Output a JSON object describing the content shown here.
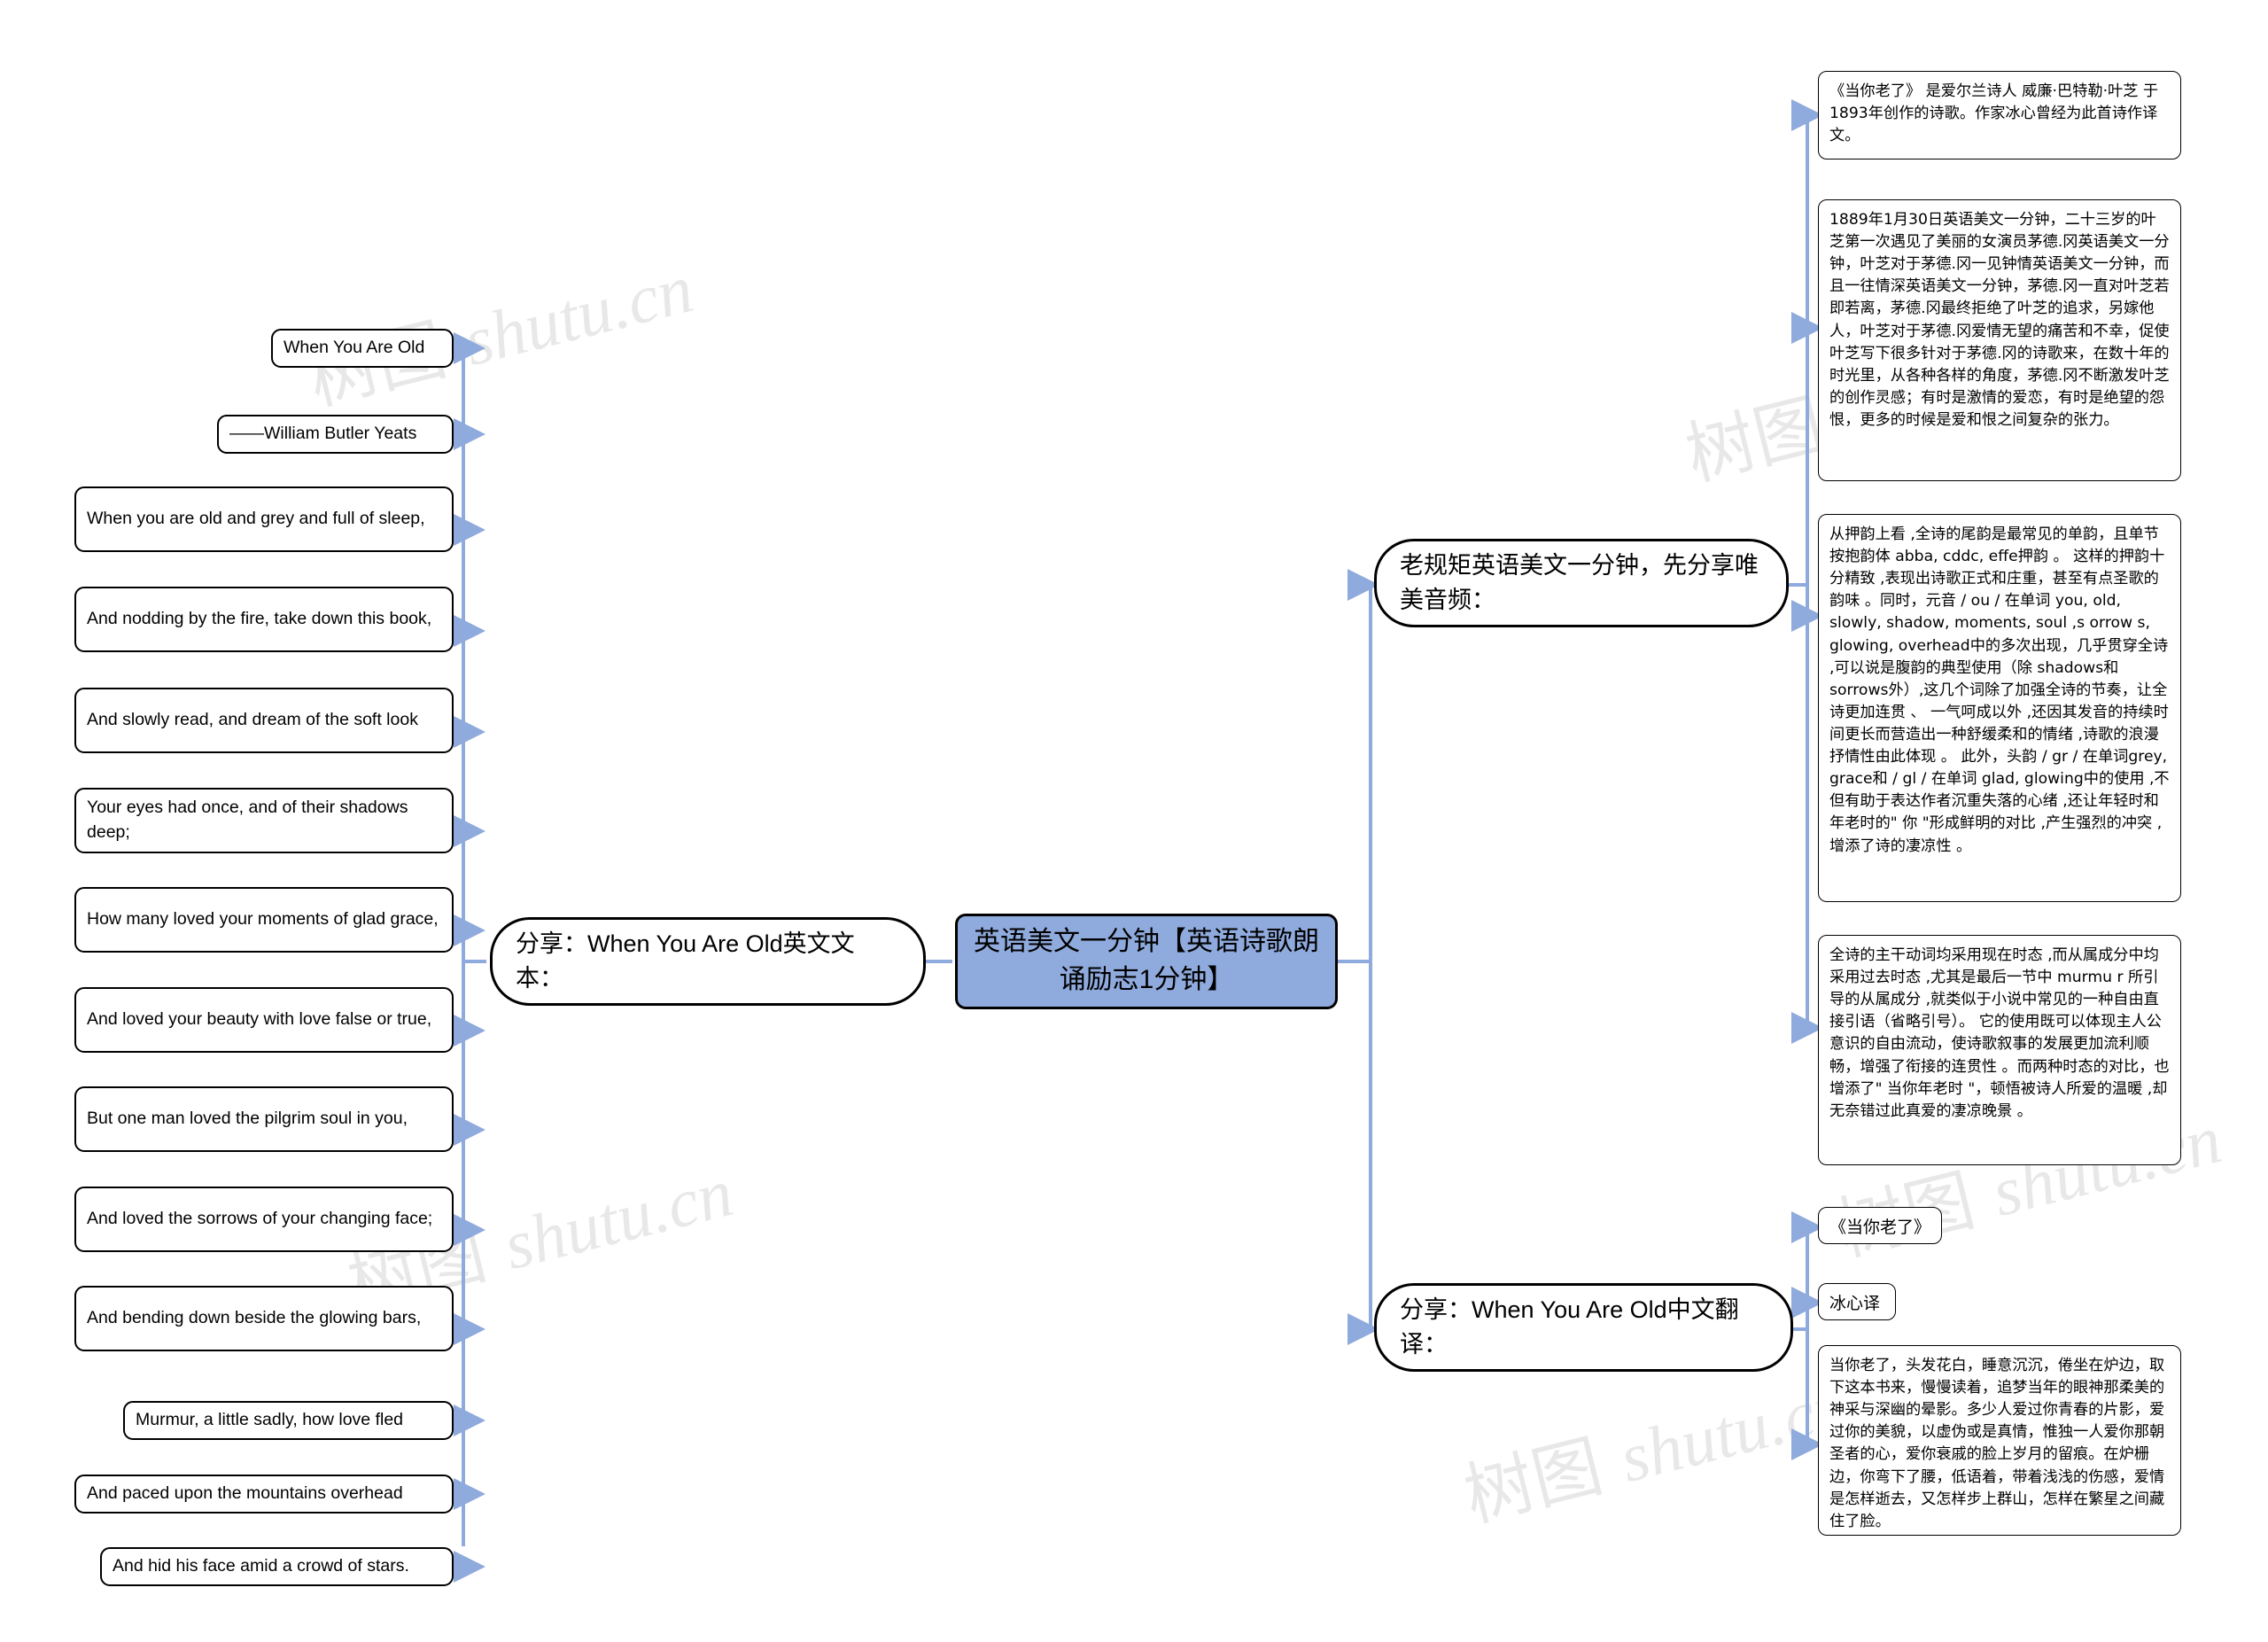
{
  "meta": {
    "watermark_text_a": "树图 ",
    "watermark_text_b": "shutu.cn",
    "accent_node_color": "#8FAADC",
    "connector_color": "#8FAADC",
    "node_border_color": "#000000",
    "canvas_background": "#FFFFFF"
  },
  "root": {
    "label": "英语美文一分钟【英语诗歌朗诵励志1分钟】"
  },
  "branches": {
    "left": {
      "label": "分享：When You Are Old英文文本：",
      "children": [
        {
          "label": "When You Are Old"
        },
        {
          "label": "——William Butler Yeats"
        },
        {
          "label": "When you are old and grey and full of sleep,"
        },
        {
          "label": "And nodding by the fire, take down this book,"
        },
        {
          "label": "And slowly read, and dream of the soft look"
        },
        {
          "label": "Your eyes had once, and of their shadows deep;"
        },
        {
          "label": "How many loved your moments of glad grace,"
        },
        {
          "label": "And loved your beauty with love false or true,"
        },
        {
          "label": "But one man loved the pilgrim soul in you,"
        },
        {
          "label": "And loved the sorrows of your changing face;"
        },
        {
          "label": "And bending down beside the glowing bars,"
        },
        {
          "label": "Murmur, a little sadly, how love fled"
        },
        {
          "label": "And paced upon the mountains overhead"
        },
        {
          "label": "And hid his face amid a crowd of stars."
        }
      ]
    },
    "right_top": {
      "label": "老规矩英语美文一分钟，先分享唯美音频：",
      "children": [
        {
          "label": "《当你老了》 是爱尔兰诗人 威廉·巴特勒·叶芝 于1893年创作的诗歌。作家冰心曾经为此首诗作译文。"
        },
        {
          "label": "1889年1月30日英语美文一分钟，二十三岁的叶芝第一次遇见了美丽的女演员茅德.冈英语美文一分钟，叶芝对于茅德.冈一见钟情英语美文一分钟，而且一往情深英语美文一分钟，茅德.冈一直对叶芝若即若离，茅德.冈最终拒绝了叶芝的追求，另嫁他人，叶芝对于茅德.冈爱情无望的痛苦和不幸，促使叶芝写下很多针对于茅德.冈的诗歌来，在数十年的时光里，从各种各样的角度，茅德.冈不断激发叶芝的创作灵感；有时是激情的爱恋，有时是绝望的怨恨，更多的时候是爱和恨之间复杂的张力。"
        },
        {
          "label": "从押韵上看 ,全诗的尾韵是最常见的单韵，且单节按抱韵体 abba, cddc, effe押韵 。 这样的押韵十分精致 ,表现出诗歌正式和庄重，甚至有点圣歌的韵味 。同时，元音 / ou / 在单词 you, old, slowly, shadow, moments, soul ,s orrow s, glowing, overhead中的多次出现，几乎贯穿全诗 ,可以说是腹韵的典型使用（除 shadows和 sorrows外）,这几个词除了加强全诗的节奏，让全诗更加连贯 、 一气呵成以外 ,还因其发音的持续时间更长而营造出一种舒缓柔和的情绪 ,诗歌的浪漫抒情性由此体现 。 此外，头韵 / gr / 在单词grey, grace和 / gl / 在单词 glad, glowing中的使用 ,不但有助于表达作者沉重失落的心绪 ,还让年轻时和年老时的\" 你 \"形成鲜明的对比 ,产生强烈的冲突 ,增添了诗的凄凉性 。"
        },
        {
          "label": "全诗的主干动词均采用现在时态 ,而从属成分中均采用过去时态 ,尤其是最后一节中 murmu r 所引导的从属成分 ,就类似于小说中常见的一种自由直接引语（省略引号）。 它的使用既可以体现主人公意识的自由流动，使诗歌叙事的发展更加流利顺畅，增强了衔接的连贯性 。而两种时态的对比，也增添了\" 当你年老时 \"，顿悟被诗人所爱的温暖 ,却无奈错过此真爱的凄凉晚景 。"
        }
      ]
    },
    "right_bottom": {
      "label": "分享：When You Are Old中文翻译：",
      "children": [
        {
          "label": "《当你老了》"
        },
        {
          "label": "冰心译"
        },
        {
          "label": "当你老了，头发花白，睡意沉沉，倦坐在炉边，取下这本书来，慢慢读着，追梦当年的眼神那柔美的神采与深幽的晕影。多少人爱过你青春的片影，爱过你的美貌，以虚伪或是真情，惟独一人爱你那朝圣者的心，爱你衰戚的脸上岁月的留痕。在炉栅边，你弯下了腰，低语着，带着浅浅的伤感，爱情是怎样逝去，又怎样步上群山，怎样在繁星之间藏住了脸。"
        }
      ]
    }
  }
}
